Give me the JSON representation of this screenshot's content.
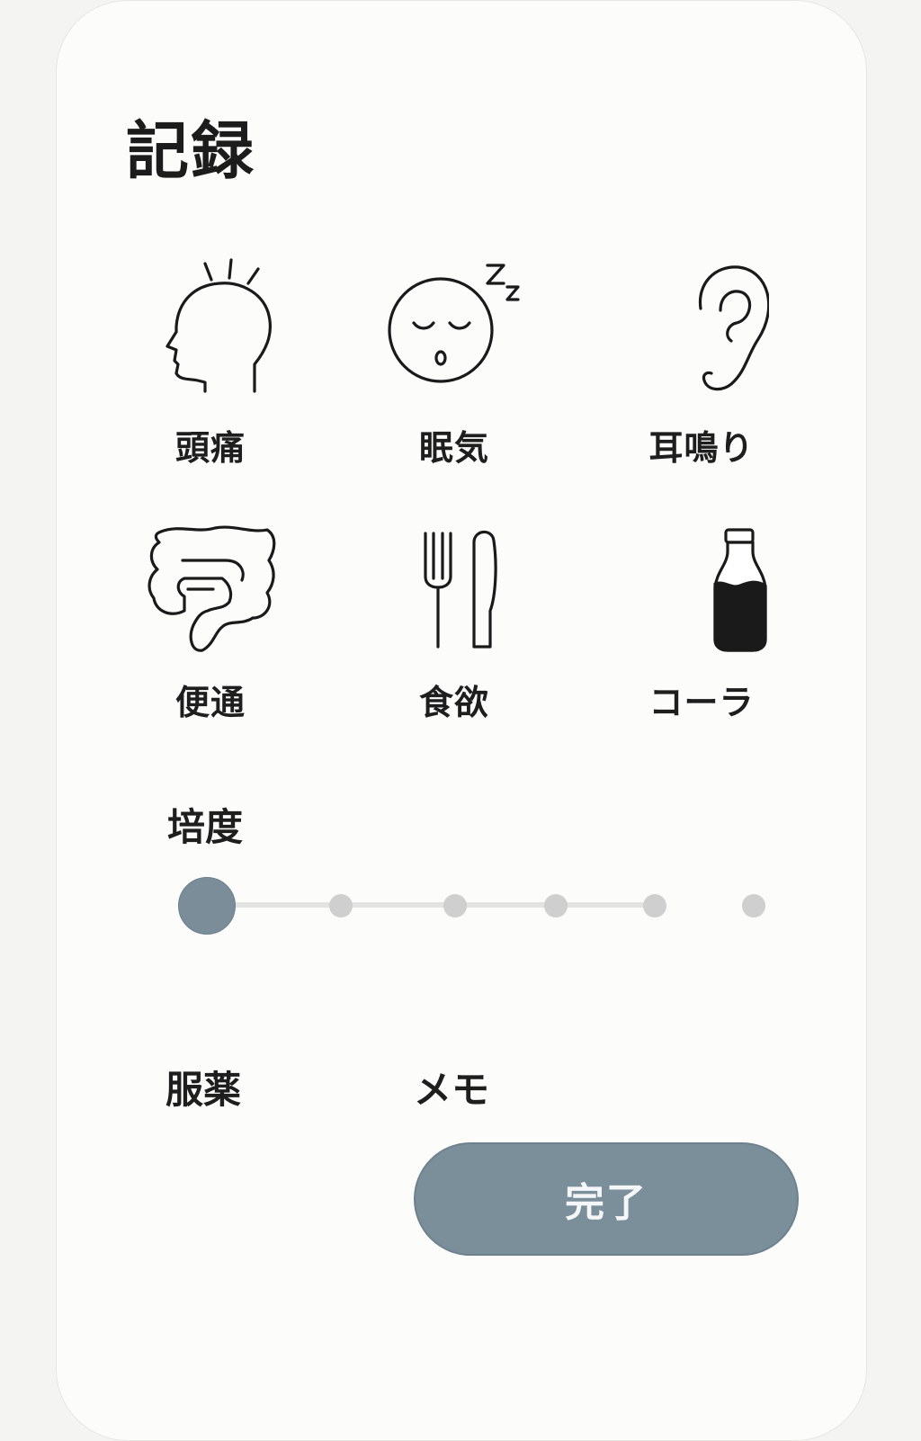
{
  "header": {
    "title": "記録"
  },
  "symptoms": [
    {
      "label": "頭痛",
      "icon": "head-pain-icon"
    },
    {
      "label": "眠気",
      "icon": "sleepy-face-icon"
    },
    {
      "label": "耳鳴り",
      "icon": "ear-icon"
    },
    {
      "label": "便通",
      "icon": "intestine-icon"
    },
    {
      "label": "食欲",
      "icon": "fork-knife-icon"
    },
    {
      "label": "コーラ",
      "icon": "bottle-icon"
    }
  ],
  "severity": {
    "label": "培度",
    "level": 0,
    "steps": 6
  },
  "medication": {
    "label": "服薬"
  },
  "memo": {
    "label": "メモ"
  },
  "done_button": {
    "label": "完了"
  },
  "colors": {
    "accent": "#7b8f9a",
    "dot": "#cfcfcf",
    "text": "#1e1e1e"
  }
}
